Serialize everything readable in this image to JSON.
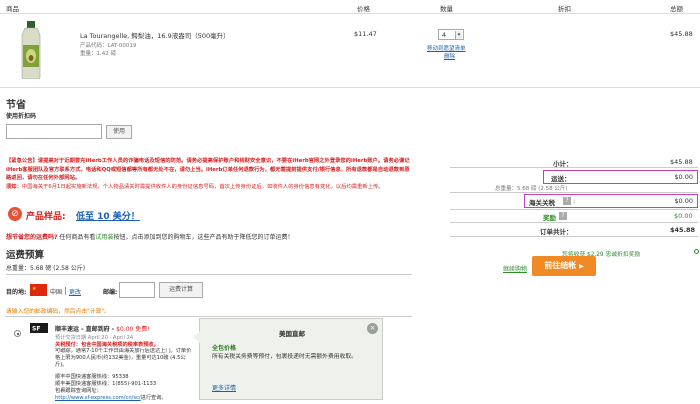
{
  "header": {
    "col_product": "商品",
    "col_price": "价格",
    "col_qty": "数量",
    "col_discount": "折扣",
    "col_total": "总额"
  },
  "item": {
    "title": "La Tourangelle, 鳄梨油，16.9液盎司（500毫升）",
    "code": "产品代码：LAT-00019",
    "weight": "重量：1.42 磅",
    "price": "$11.47",
    "qty": "4",
    "move_link": "移动到愿望清单",
    "delete_link": "删除",
    "total": "$45.88"
  },
  "savings": {
    "title": "节省",
    "coupon_label": "使用折扣码",
    "coupon_placeholder": "",
    "apply_button": "使用"
  },
  "notice": {
    "text": "【紧急公告】请提高对于近期冒充iHerb工作人员的诈骗电话及短信的防范。请务必提高保护账户和钱财安全意识，不要在iHerb官网之外登录您的iHerb账户。请务必谨记iHerb客服团队及官方联系方式，电话和QQ或短信都等所有都无处不在，请勿上当。iHerb订单任何退款行为，都无需提前提供支付/银行信息，所有退款都是自动退款到原路返回，请勿在任何外部网站。",
    "prefix": "须知：",
    "second": "中国海关于6月1日起实施新法规，个人物品清关时需提供收件人的身份证信息号码，首次上传身份证后，如收件人的身份信息有变化，以后均需重新上传。"
  },
  "sample": {
    "label": "产品样品:",
    "price_text": "低至 10 美分！"
  },
  "trial": {
    "question": "想节省您的运费吗?",
    "text1": "任何商品有看",
    "trial_link": "试用装",
    "text2": "按钮，点击添加到您的购物车，这些产品有助于降低您的订单运费！"
  },
  "shipping": {
    "title": "运费预算",
    "weight": "总重量：5.68 磅 (2.58 公斤)",
    "dest_label": "目的地:",
    "country": "中国",
    "change_link": "更改",
    "zip_label": "邮编:",
    "zip_value": "",
    "calc_button": "运费计算",
    "hint": "请输入您的邮政编码，然后点击\"计算\"。"
  },
  "option": {
    "name": "顺丰速运 - 直邮到府 -",
    "price": "$0.00 免费!",
    "eta": "预计交货日期 April 20 - April 24",
    "tax_note": "关税预付：包含中国海关税项的税率表预收。",
    "desc": "可跟踪，通常7-10个工作日由海关放行后送达上门。订单价格上限为900人民币(约132美金)，重量可达10磅 (4.5公斤)。",
    "phone1": "顺丰中国快递客服热线：95338",
    "phone2": "顺丰美国快递客服热线：1(855)-901-1133",
    "portal_label": "包裹跟踪查询网址：",
    "portal_link": "http://www.sf-express.com/cn/sc/",
    "portal_suffix": "进行查询。"
  },
  "tooltip": {
    "title": "美国直邮",
    "subtitle": "全包价格",
    "body": "所有关税关务费等预付，包裹投递时无需额外费用收取。",
    "more_link": "更多详情"
  },
  "summary": {
    "subtotal_label": "小计：",
    "subtotal_value": "$45.88",
    "shipping_label": "运送：",
    "shipping_value": "$0.00",
    "weight_note": "总重量：5.68 磅 (2.58 公斤)",
    "customs_label": "海关关税",
    "customs_value": "$0.00",
    "rewards_label": "奖励",
    "rewards_value": "$0.00",
    "order_total_label": "订单共计：",
    "order_total_value": "$45.88",
    "rewards_note": "您将收获 $2.29 忠诚折扣奖励",
    "continue_link": "继续购物",
    "checkout_button": "前往结帐"
  },
  "colors": {
    "checkout_orange": "#f08a24",
    "highlight_purple": "#c23ec9",
    "link_blue": "#1a5fb4",
    "alert_red": "#d62020",
    "rewards_green": "#2e8b2e"
  }
}
